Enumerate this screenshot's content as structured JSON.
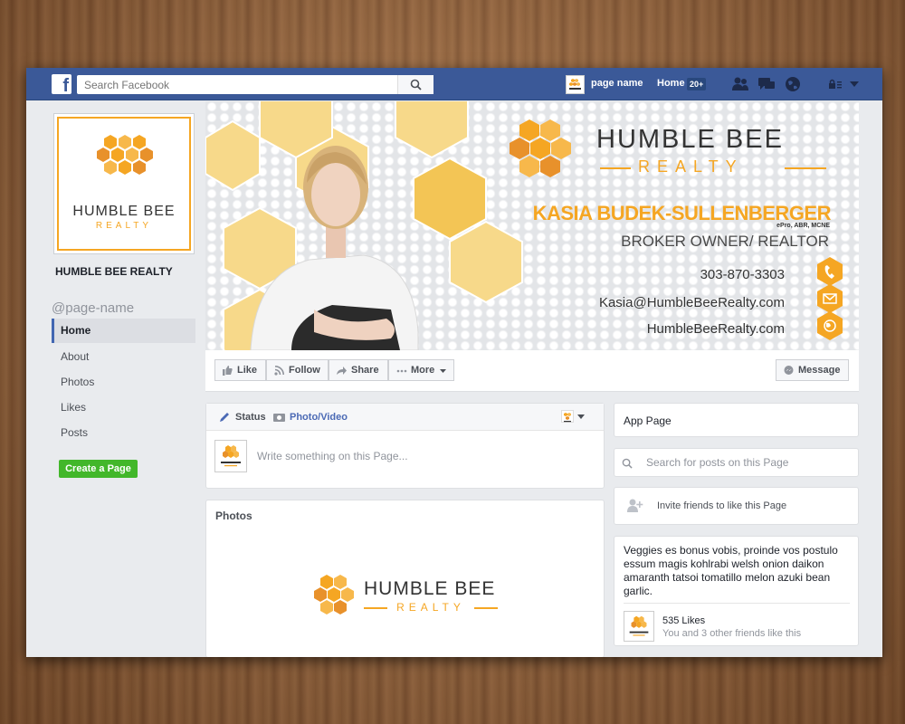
{
  "topbar": {
    "search_placeholder": "Search Facebook",
    "page_name": "page name",
    "home_label": "Home",
    "home_badge": "20+"
  },
  "brand": {
    "name_line1": "HUMBLE BEE",
    "name_line2": "REALTY",
    "orange": "#f5a623",
    "dark": "#333333"
  },
  "sidebar": {
    "page_title": "HUMBLE BEE REALTY",
    "handle": "@page-name",
    "items": [
      {
        "label": "Home",
        "active": true
      },
      {
        "label": "About"
      },
      {
        "label": "Photos"
      },
      {
        "label": "Likes"
      },
      {
        "label": "Posts"
      }
    ],
    "create_page": "Create a Page"
  },
  "cover": {
    "agent_name": "KASIA BUDEK-SULLENBERGER",
    "credentials": "ePro, ABR, MCNE",
    "role": "BROKER OWNER/ REALTOR",
    "phone": "303-870-3303",
    "email": "Kasia@HumbleBeeRealty.com",
    "website": "HumbleBeeRealty.com"
  },
  "actions": {
    "like": "Like",
    "follow": "Follow",
    "share": "Share",
    "more": "More",
    "message": "Message"
  },
  "composer": {
    "tab_status": "Status",
    "tab_photo": "Photo/Video",
    "placeholder": "Write something on this Page..."
  },
  "photos": {
    "title": "Photos"
  },
  "right": {
    "app_page": "App Page",
    "search_placeholder": "Search for posts on this Page",
    "invite": "Invite friends to like this Page",
    "blurb": "Veggies es bonus vobis, proinde vos postulo essum magis kohlrabi welsh onion daikon amaranth tatsoi tomatillo melon azuki bean garlic.",
    "likes_count": "535 Likes",
    "likes_friends": "You and 3 other friends like this"
  },
  "colors": {
    "fb_blue": "#3b5998",
    "create_green": "#42b72a"
  }
}
